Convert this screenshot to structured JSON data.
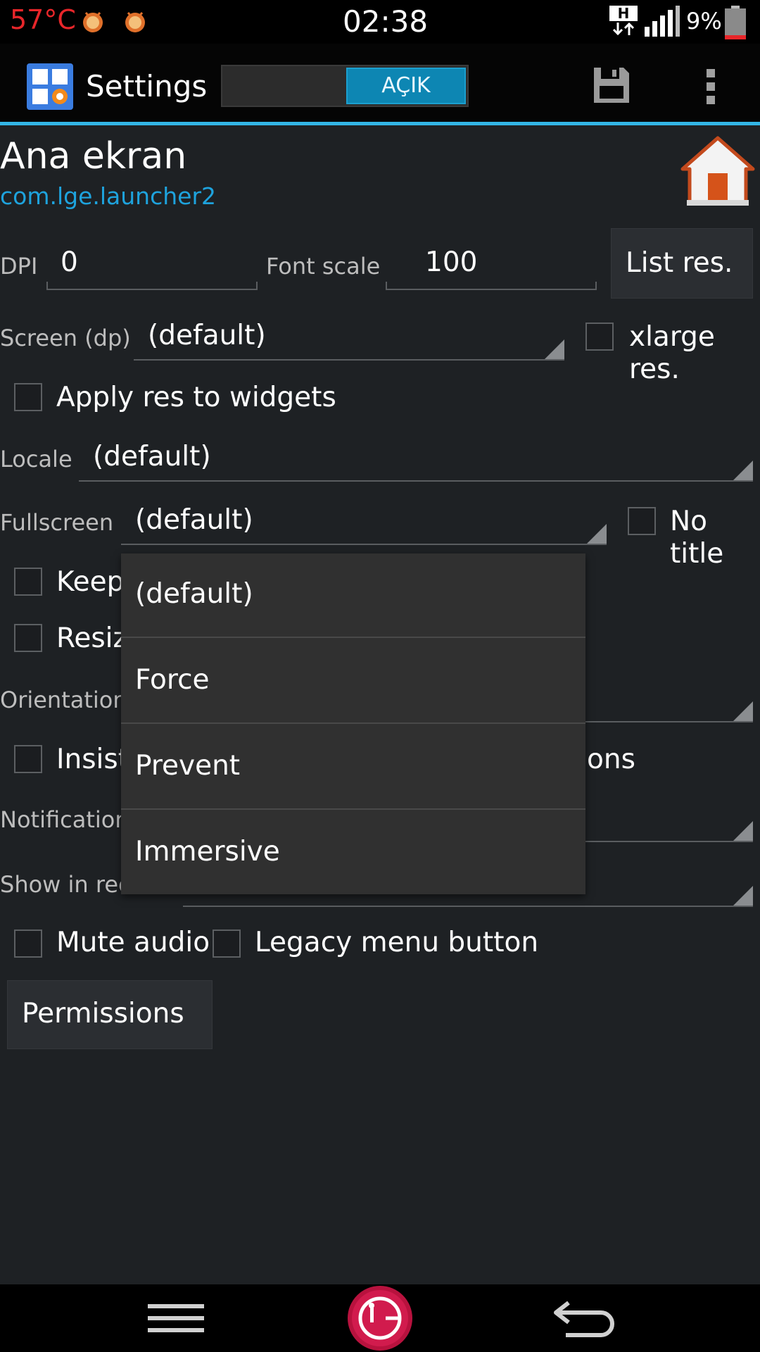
{
  "status_bar": {
    "temperature": "57°C",
    "clock": "02:38",
    "network_type": "H",
    "battery_percent": "9%"
  },
  "action_bar": {
    "title": "Settings",
    "toggle_label": "AÇIK",
    "save_icon": "save-icon",
    "overflow_icon": "overflow-menu-icon"
  },
  "header": {
    "app_name": "Ana ekran",
    "package": "com.lge.launcher2"
  },
  "dpi": {
    "label": "DPI",
    "value": "0"
  },
  "font_scale": {
    "label": "Font scale",
    "value": "100"
  },
  "list_res_button": "List res.",
  "screen": {
    "label": "Screen (dp)",
    "value": "(default)"
  },
  "xlarge": {
    "label": "xlarge res.",
    "checked": false
  },
  "apply_res": {
    "label": "Apply res to widgets",
    "checked": false
  },
  "locale": {
    "label": "Locale",
    "value": "(default)"
  },
  "fullscreen": {
    "label": "Fullscreen",
    "value": "(default)"
  },
  "no_title": {
    "label": "No title",
    "checked": false
  },
  "keep": {
    "label": "Keep"
  },
  "resize": {
    "label": "Resiz"
  },
  "orientation": {
    "label": "Orientation"
  },
  "insist": {
    "label": "Insist",
    "suffix": "ons"
  },
  "notification": {
    "label": "Notification"
  },
  "show_in_recents": {
    "label": "Show in rec"
  },
  "mute_audio": {
    "label": "Mute audio",
    "checked": false
  },
  "legacy_menu": {
    "label": "Legacy menu button",
    "checked": false
  },
  "permissions_button": "Permissions",
  "fullscreen_dropdown": {
    "options": [
      "(default)",
      "Force",
      "Prevent",
      "Immersive"
    ]
  },
  "nav_bar": {
    "menu_icon": "menu-icon",
    "home_icon": "lg-home-icon",
    "back_icon": "back-icon"
  },
  "colors": {
    "accent": "#33b5e5",
    "package_link": "#1ea3dd",
    "temperature": "#e8262a",
    "toggle_on": "#0d86b3"
  }
}
